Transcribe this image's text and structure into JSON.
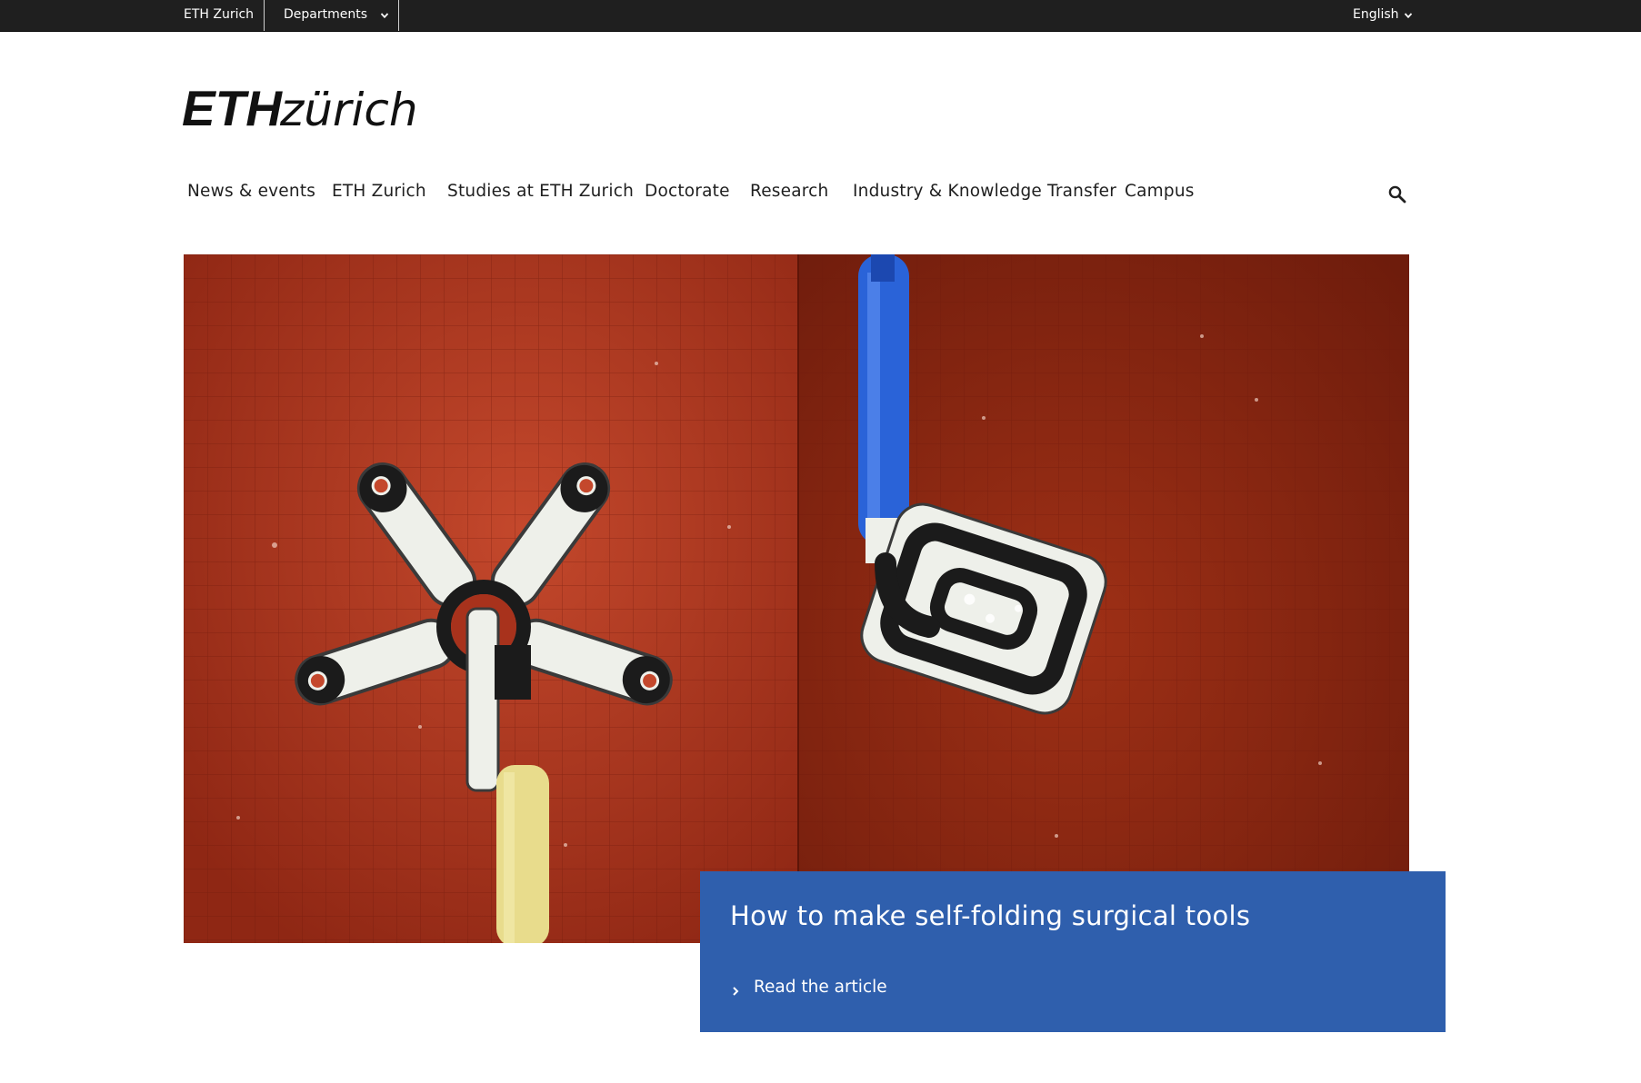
{
  "topbar": {
    "home_label": "ETH Zurich",
    "departments_label": "Departments",
    "language_label": "English"
  },
  "logo": {
    "text_bold": "ETH",
    "text_light": "zürich"
  },
  "mainnav": {
    "items": [
      {
        "label": "News & events"
      },
      {
        "label": "ETH Zurich"
      },
      {
        "label": "Studies at ETH Zurich"
      },
      {
        "label": "Doctorate"
      },
      {
        "label": "Research"
      },
      {
        "label": "Industry & Knowledge Transfer"
      },
      {
        "label": "Campus"
      }
    ],
    "search_icon": "search-icon"
  },
  "hero": {
    "teaser_title": "How to make self-folding surgical tools",
    "teaser_link": "Read the article"
  },
  "colors": {
    "topbar_bg": "#1f1f1f",
    "teaser_bg": "#2f5fad",
    "hero_red": "#a8321c",
    "text": "#1f1f1f"
  }
}
